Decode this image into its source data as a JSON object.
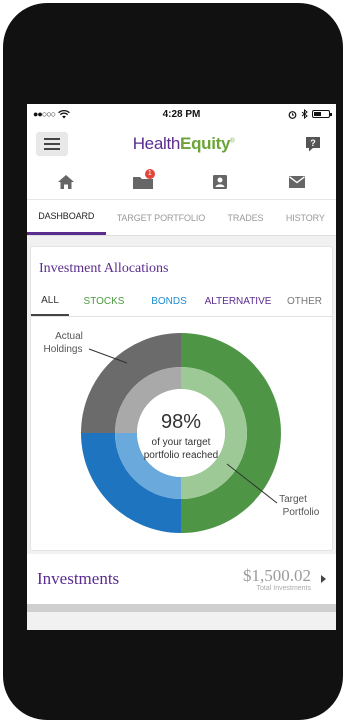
{
  "status_bar": {
    "signal": "●●○○○",
    "time": "4:28 PM"
  },
  "header": {
    "logo_part1": "Health",
    "logo_part2": "Equity",
    "logo_mark": "®",
    "menu_icon": "hamburger-icon",
    "help_icon": "help-icon"
  },
  "icon_nav": {
    "items": [
      {
        "icon": "home-icon"
      },
      {
        "icon": "folder-icon",
        "badge": "1"
      },
      {
        "icon": "profile-icon"
      },
      {
        "icon": "mail-icon"
      }
    ]
  },
  "tabs": [
    {
      "label": "DASHBOARD",
      "active": true
    },
    {
      "label": "TARGET PORTFOLIO",
      "active": false
    },
    {
      "label": "TRADES",
      "active": false
    },
    {
      "label": "HISTORY",
      "active": false
    }
  ],
  "allocations": {
    "title": "Investment Allocations",
    "filters": [
      "ALL",
      "STOCKS",
      "BONDS",
      "ALTERNATIVE",
      "OTHER"
    ],
    "percent": "98%",
    "caption_line1": "of your target",
    "caption_line2": "portfolio reached",
    "label_actual_1": "Actual",
    "label_actual_2": "Holdings",
    "label_target_1": "Target",
    "label_target_2": "Portfolio",
    "target_progress": 0.98
  },
  "chart_data": {
    "type": "pie",
    "rings": [
      {
        "name": "Actual Holdings",
        "slices": [
          {
            "category": "Stocks",
            "value": 50,
            "color": "#4f9546"
          },
          {
            "category": "Bonds",
            "value": 25,
            "color": "#1f74c0"
          },
          {
            "category": "Alternative",
            "value": 25,
            "color": "#6b6b6b"
          }
        ]
      },
      {
        "name": "Target Portfolio",
        "slices": [
          {
            "category": "Stocks",
            "value": 50,
            "color": "#9cc995"
          },
          {
            "category": "Bonds",
            "value": 25,
            "color": "#6aa9dc"
          },
          {
            "category": "Alternative",
            "value": 25,
            "color": "#a9a9a9"
          }
        ]
      }
    ]
  },
  "investments": {
    "title": "Investments",
    "amount": "$1,500.02",
    "caption": "Total Investments"
  },
  "colors": {
    "brand_purple": "#5b2d8e",
    "brand_green": "#6ba539",
    "badge_red": "#e0453a"
  }
}
